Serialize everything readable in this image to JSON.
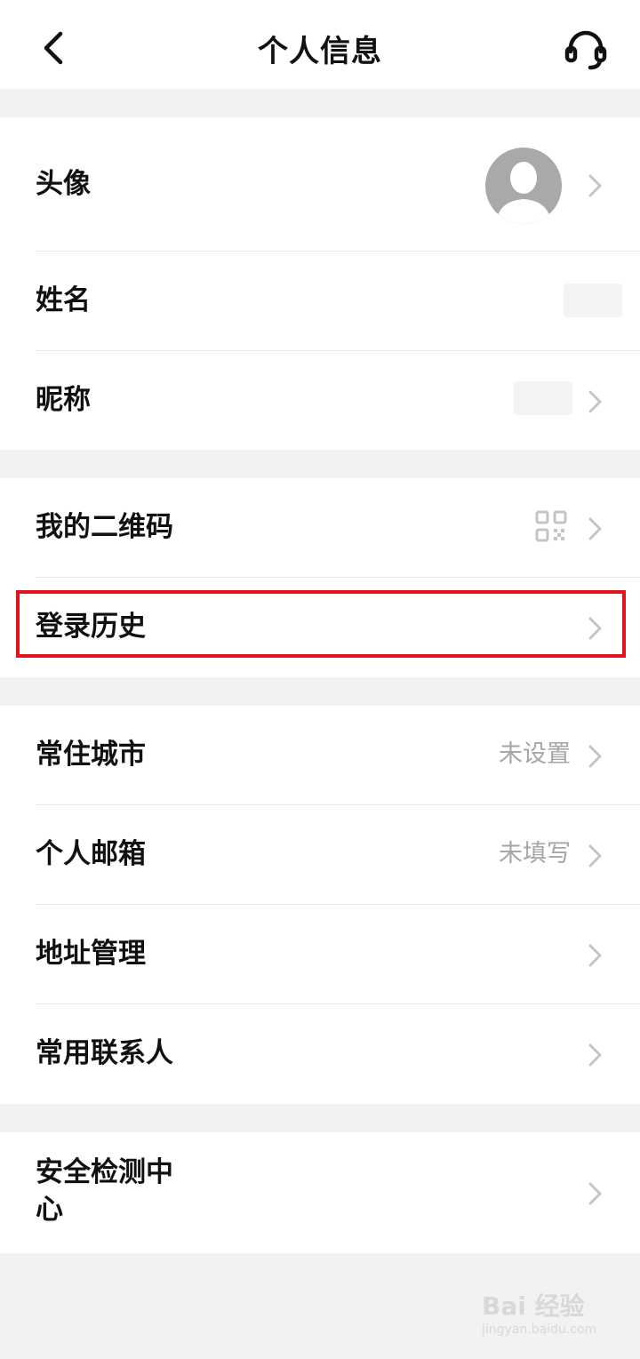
{
  "header": {
    "title": "个人信息",
    "back_icon": "chevron-left-icon",
    "support_icon": "headset-icon"
  },
  "profile": {
    "avatar_label": "头像",
    "name_label": "姓名",
    "nickname_label": "昵称"
  },
  "account": {
    "qrcode_label": "我的二维码",
    "qrcode_icon": "qr-code-icon",
    "login_history_label": "登录历史"
  },
  "details": {
    "city_label": "常住城市",
    "city_value": "未设置",
    "email_label": "个人邮箱",
    "email_value": "未填写",
    "address_label": "地址管理",
    "contacts_label": "常用联系人"
  },
  "security": {
    "label_line1": "安全检测中",
    "label_line2": "心"
  },
  "highlight_color": "#e0141b",
  "watermark": {
    "brand": "Bai 经验",
    "url": "jingyan.baidu.com"
  }
}
